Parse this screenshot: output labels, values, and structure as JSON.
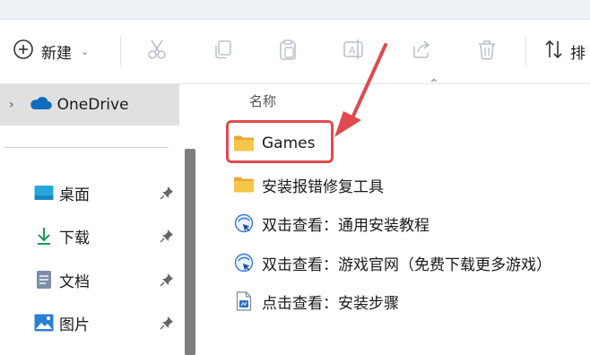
{
  "toolbar": {
    "new_label": "新建",
    "sort_label": "排",
    "icons": [
      "add-icon",
      "cut-icon",
      "copy-icon",
      "paste-icon",
      "rename-icon",
      "share-icon",
      "delete-icon",
      "sort-icon"
    ]
  },
  "sidebar": {
    "onedrive_label": "OneDrive",
    "items": [
      {
        "label": "桌面",
        "icon": "desktop-icon"
      },
      {
        "label": "下载",
        "icon": "download-icon"
      },
      {
        "label": "文档",
        "icon": "documents-icon"
      },
      {
        "label": "图片",
        "icon": "pictures-icon"
      }
    ]
  },
  "content": {
    "column_header": "名称",
    "files": [
      {
        "label": "Games",
        "icon": "folder-icon"
      },
      {
        "label": "安装报错修复工具",
        "icon": "folder-icon"
      },
      {
        "label": "双击查看：通用安装教程",
        "icon": "internet-shortcut-icon"
      },
      {
        "label": "双击查看：游戏官网（免费下载更多游戏）",
        "icon": "internet-shortcut-icon"
      },
      {
        "label": "点击查看：安装步骤",
        "icon": "document-file-icon"
      }
    ]
  },
  "colors": {
    "highlight": "#e04a4f",
    "folder": "#f6c648",
    "onedrive_blue": "#0f6cbd",
    "selected_bg": "#e0e0e0"
  }
}
